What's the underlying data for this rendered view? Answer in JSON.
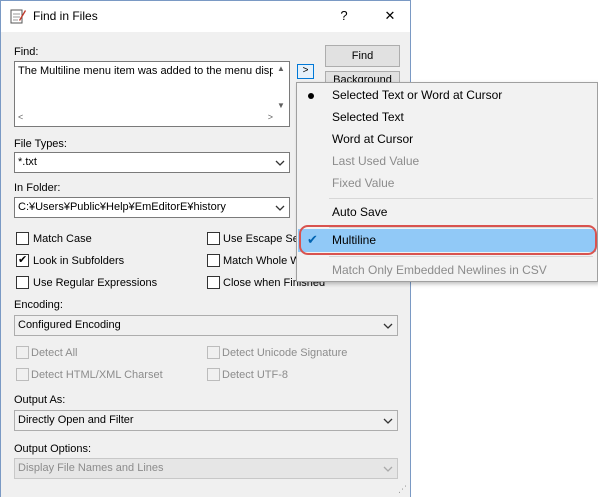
{
  "window": {
    "title": "Find in Files",
    "help_label": "?",
    "close_label": "✕"
  },
  "find": {
    "label": "Find:",
    "value": "The Multiline menu item was added to the menu displa",
    "arrow_button_label": ">"
  },
  "file_types": {
    "label": "File Types:",
    "value": "*.txt"
  },
  "in_folder": {
    "label": "In Folder:",
    "value": "C:¥Users¥Public¥Help¥EmEditorE¥history"
  },
  "buttons": {
    "find_label": "Find",
    "second_label": "Background"
  },
  "checkboxes": [
    {
      "label": "Match Case",
      "checked": false
    },
    {
      "label": "Look in Subfolders",
      "checked": true
    },
    {
      "label": "Use Regular Expressions",
      "checked": false
    },
    {
      "label": "Use Escape Sec",
      "checked": false
    },
    {
      "label": "Match Whole W",
      "checked": false
    },
    {
      "label": "Close when Finished",
      "checked": false
    }
  ],
  "encoding": {
    "label": "Encoding:",
    "value": "Configured Encoding"
  },
  "detect": [
    {
      "label": "Detect All"
    },
    {
      "label": "Detect Unicode Signature"
    },
    {
      "label": "Detect HTML/XML Charset"
    },
    {
      "label": "Detect UTF-8"
    }
  ],
  "output_as": {
    "label": "Output As:",
    "value": "Directly Open and Filter"
  },
  "output_options": {
    "label": "Output Options:",
    "value": "Display File Names and Lines"
  },
  "menu": {
    "items": [
      {
        "label": "Selected Text or Word at Cursor",
        "marker": "bullet",
        "enabled": true
      },
      {
        "label": "Selected Text",
        "enabled": true
      },
      {
        "label": "Word at Cursor",
        "enabled": true
      },
      {
        "label": "Last Used Value",
        "enabled": false
      },
      {
        "label": "Fixed Value",
        "enabled": false
      },
      {
        "label": "Auto Save",
        "enabled": true
      },
      {
        "label": "Multiline",
        "marker": "check",
        "enabled": true,
        "highlighted": true
      },
      {
        "label": "Match Only Embedded Newlines in CSV",
        "enabled": false
      }
    ]
  },
  "colors": {
    "highlight": "#91c9f7",
    "annotation_ring": "#d9534f",
    "check_color": "#0063b1"
  }
}
